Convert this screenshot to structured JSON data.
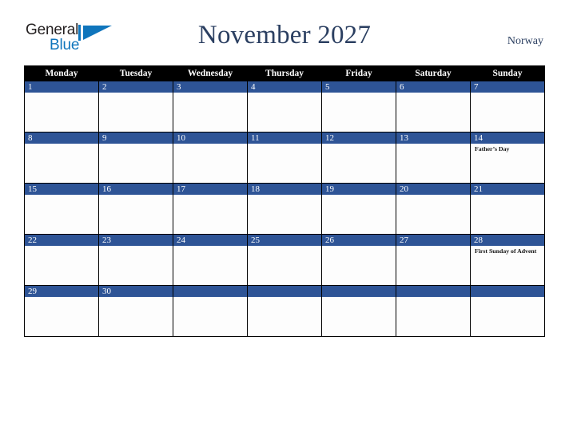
{
  "logo": {
    "text_top": "General",
    "text_bottom": "Blue",
    "triangle_icon": "triangle-icon",
    "color_top": "#231f20",
    "color_bottom": "#0f75bc"
  },
  "header": {
    "title": "November 2027",
    "country": "Norway",
    "title_color": "#2b3f61"
  },
  "calendar": {
    "weekday_headers": [
      "Monday",
      "Tuesday",
      "Wednesday",
      "Thursday",
      "Friday",
      "Saturday",
      "Sunday"
    ],
    "header_bg": "#000000",
    "daynum_bg": "#2e5496",
    "cell_bg": "#fdfdfd",
    "weeks": [
      [
        {
          "day": "1",
          "events": []
        },
        {
          "day": "2",
          "events": []
        },
        {
          "day": "3",
          "events": []
        },
        {
          "day": "4",
          "events": []
        },
        {
          "day": "5",
          "events": []
        },
        {
          "day": "6",
          "events": []
        },
        {
          "day": "7",
          "events": []
        }
      ],
      [
        {
          "day": "8",
          "events": []
        },
        {
          "day": "9",
          "events": []
        },
        {
          "day": "10",
          "events": []
        },
        {
          "day": "11",
          "events": []
        },
        {
          "day": "12",
          "events": []
        },
        {
          "day": "13",
          "events": []
        },
        {
          "day": "14",
          "events": [
            "Father’s Day"
          ]
        }
      ],
      [
        {
          "day": "15",
          "events": []
        },
        {
          "day": "16",
          "events": []
        },
        {
          "day": "17",
          "events": []
        },
        {
          "day": "18",
          "events": []
        },
        {
          "day": "19",
          "events": []
        },
        {
          "day": "20",
          "events": []
        },
        {
          "day": "21",
          "events": []
        }
      ],
      [
        {
          "day": "22",
          "events": []
        },
        {
          "day": "23",
          "events": []
        },
        {
          "day": "24",
          "events": []
        },
        {
          "day": "25",
          "events": []
        },
        {
          "day": "26",
          "events": []
        },
        {
          "day": "27",
          "events": []
        },
        {
          "day": "28",
          "events": [
            "First Sunday of Advent"
          ]
        }
      ],
      [
        {
          "day": "29",
          "events": []
        },
        {
          "day": "30",
          "events": []
        },
        {
          "day": "",
          "events": []
        },
        {
          "day": "",
          "events": []
        },
        {
          "day": "",
          "events": []
        },
        {
          "day": "",
          "events": []
        },
        {
          "day": "",
          "events": []
        }
      ]
    ]
  }
}
